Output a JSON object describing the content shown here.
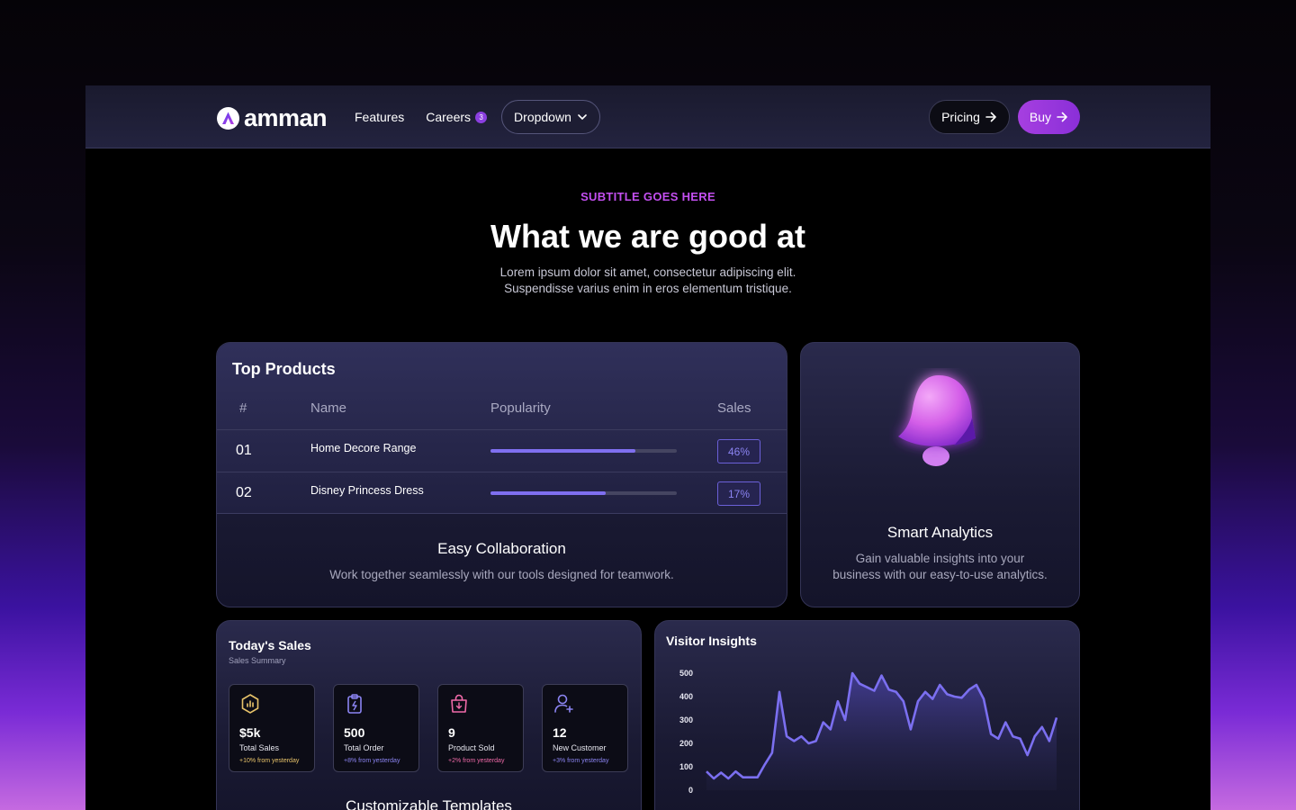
{
  "nav": {
    "brand": "amman",
    "links": [
      {
        "label": "Features"
      },
      {
        "label": "Careers",
        "badge": "3"
      }
    ],
    "dropdown_label": "Dropdown",
    "pricing_label": "Pricing",
    "buy_label": "Buy"
  },
  "hero": {
    "subtitle": "SUBTITLE GOES HERE",
    "title": "What we are good at",
    "lead_line1": "Lorem ipsum dolor sit amet, consectetur adipiscing elit.",
    "lead_line2": "Suspendisse varius enim in eros elementum tristique."
  },
  "top_products": {
    "title": "Top Products",
    "columns": [
      "#",
      "Name",
      "Popularity",
      "Sales"
    ],
    "rows": [
      {
        "num": "01",
        "name": "Home Decore Range",
        "popularity": 0.78,
        "sales": "46%"
      },
      {
        "num": "02",
        "name": "Disney Princess Dress",
        "popularity": 0.62,
        "sales": "17%"
      }
    ],
    "feature_title": "Easy Collaboration",
    "feature_text": "Work together seamlessly with our tools designed for teamwork."
  },
  "analytics": {
    "title": "Smart Analytics",
    "text_line1": "Gain valuable insights into your",
    "text_line2": "business with our easy-to-use analytics.",
    "icon": "bell-icon"
  },
  "todays_sales": {
    "title": "Today's Sales",
    "subtitle": "Sales Summary",
    "stats": [
      {
        "value": "$5k",
        "label": "Total Sales",
        "change": "+10% from yesterday",
        "icon": "chart-badge-icon",
        "color": "#e8c36a"
      },
      {
        "value": "500",
        "label": "Total Order",
        "change": "+8% from yesterday",
        "icon": "clipboard-icon",
        "color": "#8b84f2"
      },
      {
        "value": "9",
        "label": "Product Sold",
        "change": "+2% from yesterday",
        "icon": "shopping-bag-icon",
        "color": "#f06aa8"
      },
      {
        "value": "12",
        "label": "New Customer",
        "change": "+3% from yesterday",
        "icon": "add-user-icon",
        "color": "#8b84f2"
      }
    ],
    "footer_title": "Customizable Templates"
  },
  "visitor_insights": {
    "title": "Visitor Insights"
  },
  "chart_data": {
    "type": "area",
    "title": "Visitor Insights",
    "yticks": [
      0,
      100,
      200,
      300,
      400,
      500
    ],
    "ylim": [
      0,
      500
    ],
    "values": [
      80,
      50,
      75,
      50,
      80,
      55,
      55,
      55,
      110,
      160,
      420,
      230,
      210,
      230,
      200,
      210,
      290,
      260,
      380,
      300,
      500,
      455,
      440,
      425,
      490,
      430,
      420,
      380,
      260,
      380,
      420,
      390,
      450,
      410,
      400,
      395,
      430,
      450,
      390,
      240,
      220,
      290,
      230,
      220,
      150,
      230,
      270,
      210,
      310
    ],
    "line_color": "#7b6ff0"
  }
}
